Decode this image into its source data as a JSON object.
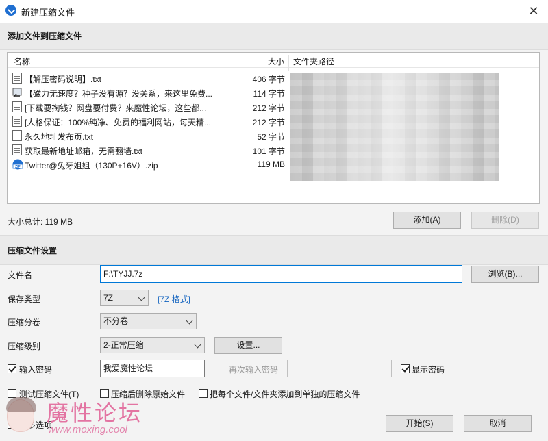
{
  "window": {
    "title": "新建压缩文件",
    "close_glyph": "✕"
  },
  "add_section": {
    "header": "添加文件到压缩文件",
    "columns": {
      "name": "名称",
      "size": "大小",
      "path": "文件夹路径"
    },
    "files": [
      {
        "icon": "text-file-icon",
        "name": "【解压密码说明】.txt",
        "size": "406 字节"
      },
      {
        "icon": "shortcut-file-icon",
        "name": "【磁力无速度？种子没有源？没关系，来这里免费...",
        "size": "114 字节"
      },
      {
        "icon": "text-file-icon",
        "name": "[下载要掏钱？网盘要付费？来魔性论坛，这些都...",
        "size": "212 字节"
      },
      {
        "icon": "text-file-icon",
        "name": "[人格保证：100%纯净、免费的福利网站，每天精...",
        "size": "212 字节"
      },
      {
        "icon": "text-file-icon",
        "name": "永久地址发布页.txt",
        "size": "52 字节"
      },
      {
        "icon": "text-file-icon",
        "name": "获取最新地址邮箱，无需翻墙.txt",
        "size": "101 字节"
      },
      {
        "icon": "zip-archive-icon",
        "name": "Twitter@兔牙姐姐（130P+16V）.zip",
        "size": "119 MB"
      }
    ],
    "total_label": "大小总计: 119 MB",
    "add_button": "添加(A)",
    "remove_button": "删除(D)"
  },
  "settings": {
    "header": "压缩文件设置",
    "filename_label": "文件名",
    "filename_value": "F:\\TYJJ.7z",
    "browse_button": "浏览(B)...",
    "save_type_label": "保存类型",
    "save_type_value": "7Z",
    "format_link": "[7Z 格式]",
    "split_label": "压缩分卷",
    "split_value": "不分卷",
    "level_label": "压缩级别",
    "level_value": "2-正常压缩",
    "config_button": "设置...",
    "password_checkbox": "输入密码",
    "password_checked": true,
    "password_value": "我爱魔性论坛",
    "reenter_label": "再次输入密码",
    "reenter_value": "",
    "show_password": "显示密码",
    "show_password_checked": true,
    "test_archive": "测试压缩文件(T)",
    "test_archive_checked": false,
    "delete_after": "压缩后删除原始文件",
    "delete_after_checked": false,
    "each_separate": "把每个文件/文件夹添加到单独的压缩文件",
    "each_separate_checked": false,
    "more_options": "更多选项",
    "more_options_checked": true,
    "start_button": "开始(S)",
    "cancel_button": "取消"
  },
  "watermark": {
    "title": "魔性论坛",
    "url": "www.moxing.cool"
  },
  "colors": {
    "accent": "#0078d7",
    "link": "#1565c0",
    "watermark": "#e2679a"
  }
}
